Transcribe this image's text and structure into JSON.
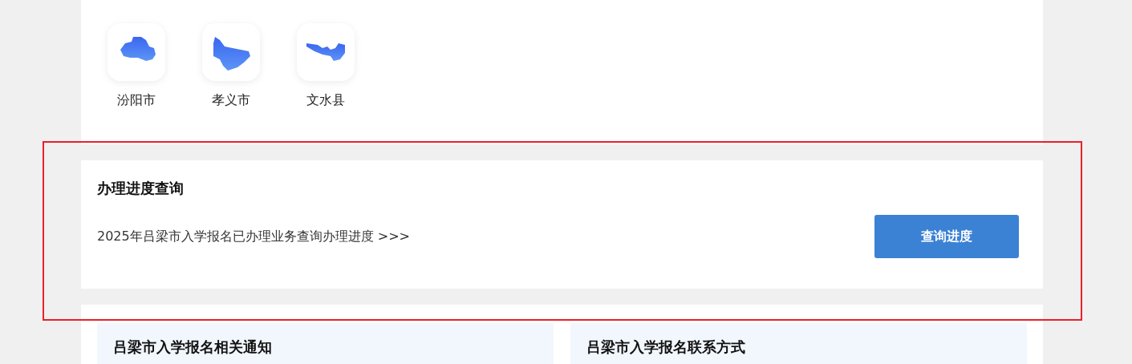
{
  "regions": [
    {
      "name": "汾阳市"
    },
    {
      "name": "孝义市"
    },
    {
      "name": "文水县"
    }
  ],
  "progress": {
    "title": "办理进度查询",
    "description": "2025年吕梁市入学报名已办理业务查询办理进度 >>>",
    "button": "查询进度",
    "highlighted": true
  },
  "cards": [
    {
      "title": "吕梁市入学报名相关通知"
    },
    {
      "title": "吕梁市入学报名联系方式"
    }
  ]
}
